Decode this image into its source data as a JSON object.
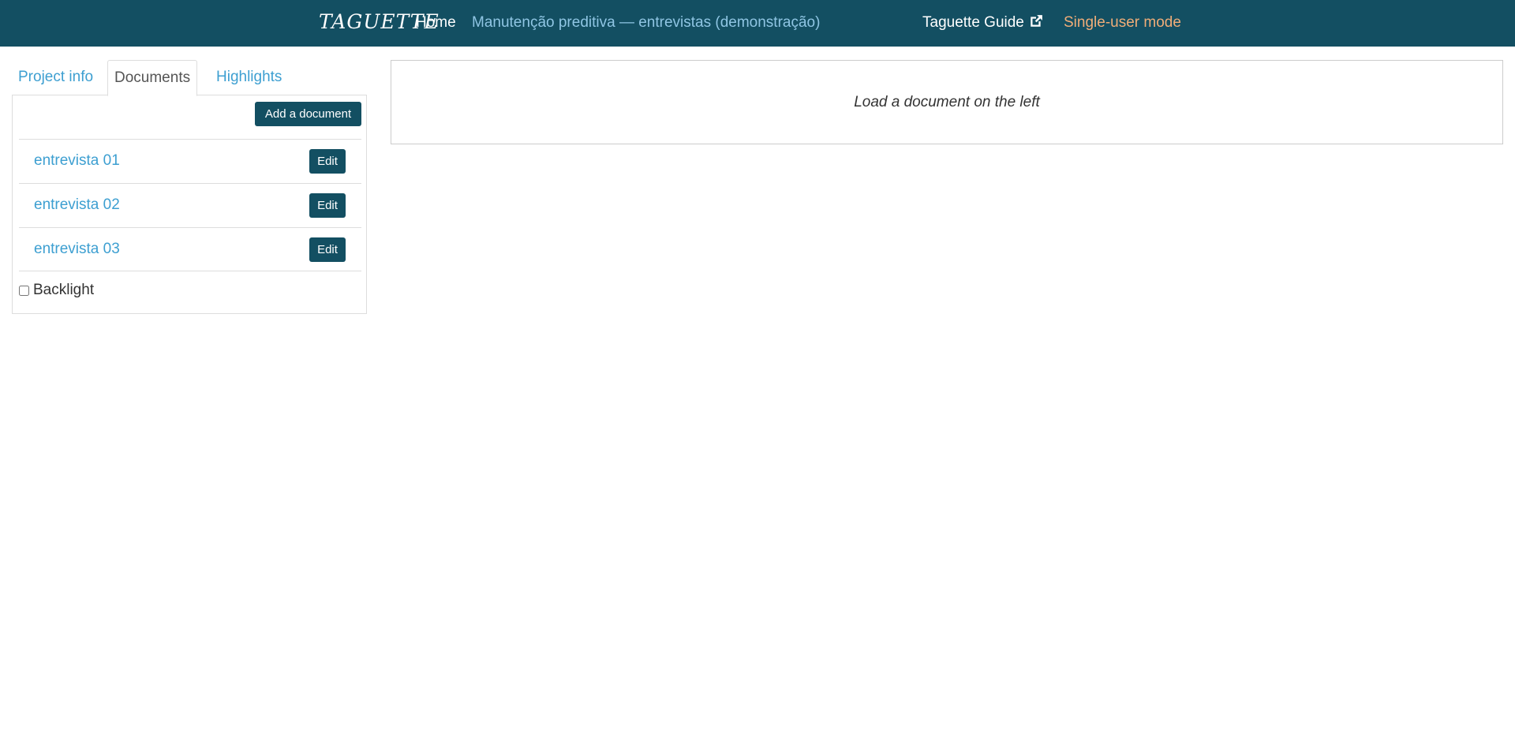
{
  "navbar": {
    "brand": "TAGUETTE",
    "home": "Home",
    "project_title": "Manutenção preditiva — entrevistas (demonstração)",
    "guide": "Taguette Guide",
    "guide_icon": "external-link-icon",
    "mode": "Single-user mode"
  },
  "tabs": [
    {
      "label": "Project info"
    },
    {
      "label": "Documents",
      "active": true
    },
    {
      "label": "Highlights"
    }
  ],
  "documents": {
    "add_label": "Add a document",
    "edit_label": "Edit",
    "items": [
      {
        "name": "entrevista 01"
      },
      {
        "name": "entrevista 02"
      },
      {
        "name": "entrevista 03"
      }
    ],
    "backlight_label": "Backlight",
    "backlight_checked": false
  },
  "viewer": {
    "placeholder": "Load a document on the left"
  },
  "colors": {
    "navbar_bg": "#134f62",
    "link": "#3d9fd1",
    "mode_text": "#f0ad78",
    "button_bg": "#134f62"
  }
}
